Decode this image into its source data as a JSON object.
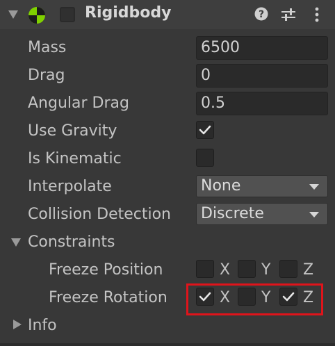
{
  "component": {
    "title": "Rigidbody"
  },
  "fields": {
    "mass_label": "Mass",
    "mass_value": "6500",
    "drag_label": "Drag",
    "drag_value": "0",
    "angular_drag_label": "Angular Drag",
    "angular_drag_value": "0.5",
    "use_gravity_label": "Use Gravity",
    "use_gravity_checked": true,
    "is_kinematic_label": "Is Kinematic",
    "is_kinematic_checked": false,
    "interpolate_label": "Interpolate",
    "interpolate_value": "None",
    "collision_detection_label": "Collision Detection",
    "collision_detection_value": "Discrete"
  },
  "constraints": {
    "label": "Constraints",
    "freeze_position": {
      "label": "Freeze Position",
      "x": false,
      "y": false,
      "z": false
    },
    "freeze_rotation": {
      "label": "Freeze Rotation",
      "x": true,
      "y": false,
      "z": true
    },
    "axis_x": "X",
    "axis_y": "Y",
    "axis_z": "Z"
  },
  "info": {
    "label": "Info"
  },
  "colors": {
    "background": "#383838",
    "highlight_border": "#e0141b",
    "rigidbody_icon": "#7fd000"
  },
  "icons": {
    "foldout": "triangle-down-icon",
    "component": "rigidbody-icon",
    "help": "help-icon",
    "presets": "sliders-icon",
    "menu": "kebab-menu-icon"
  }
}
